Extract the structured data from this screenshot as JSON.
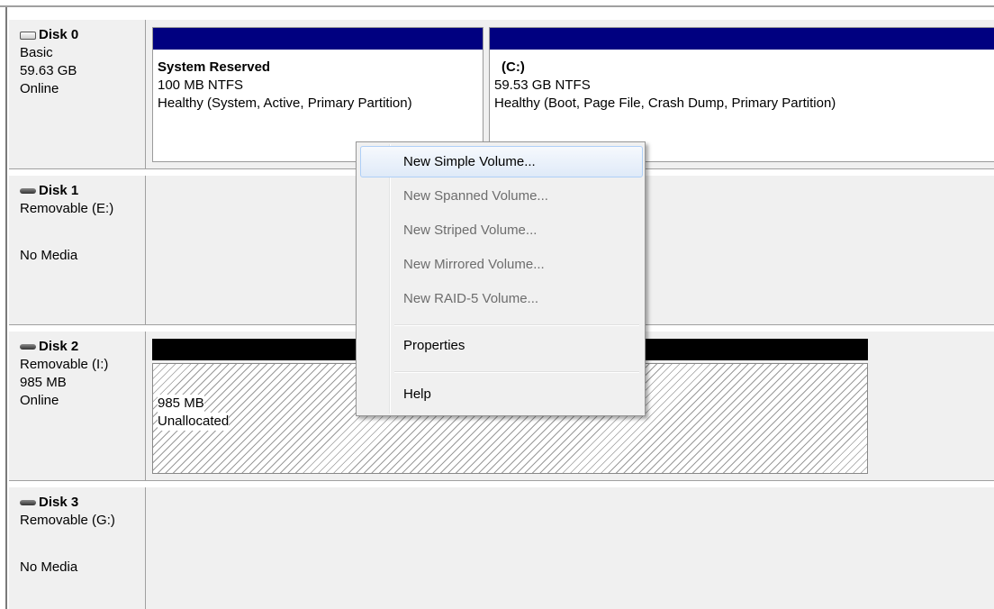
{
  "disks": [
    {
      "name": "Disk 0",
      "line1": "Basic",
      "line2": "59.63 GB",
      "line3": "Online",
      "icon": "basic-disk-icon"
    },
    {
      "name": "Disk 1",
      "line1": "Removable (E:)",
      "line2": "",
      "line3": "No Media",
      "icon": "removable-disk-icon"
    },
    {
      "name": "Disk 2",
      "line1": "Removable (I:)",
      "line2": "985 MB",
      "line3": "Online",
      "icon": "removable-disk-icon"
    },
    {
      "name": "Disk 3",
      "line1": "Removable (G:)",
      "line2": "",
      "line3": "No Media",
      "icon": "removable-disk-icon"
    }
  ],
  "partitions": {
    "system_reserved": {
      "label": "System Reserved",
      "size": "100 MB NTFS",
      "status": "Healthy (System, Active, Primary Partition)"
    },
    "c_drive": {
      "label": "(C:)",
      "size": "59.53 GB NTFS",
      "status": "Healthy (Boot, Page File, Crash Dump, Primary Partition)"
    },
    "unallocated": {
      "size": "985 MB",
      "status": "Unallocated"
    }
  },
  "context_menu": {
    "items": [
      {
        "label": "New Simple Volume...",
        "enabled": true,
        "selected": true
      },
      {
        "label": "New Spanned Volume...",
        "enabled": false
      },
      {
        "label": "New Striped Volume...",
        "enabled": false
      },
      {
        "label": "New Mirrored Volume...",
        "enabled": false
      },
      {
        "label": "New RAID-5 Volume...",
        "enabled": false
      },
      {
        "label": "Properties",
        "enabled": true
      },
      {
        "label": "Help",
        "enabled": true
      }
    ]
  },
  "colors": {
    "primary_partition_bar": "#000080",
    "unallocated_bar": "#000000",
    "menu_highlight": "#dfeaf8"
  }
}
